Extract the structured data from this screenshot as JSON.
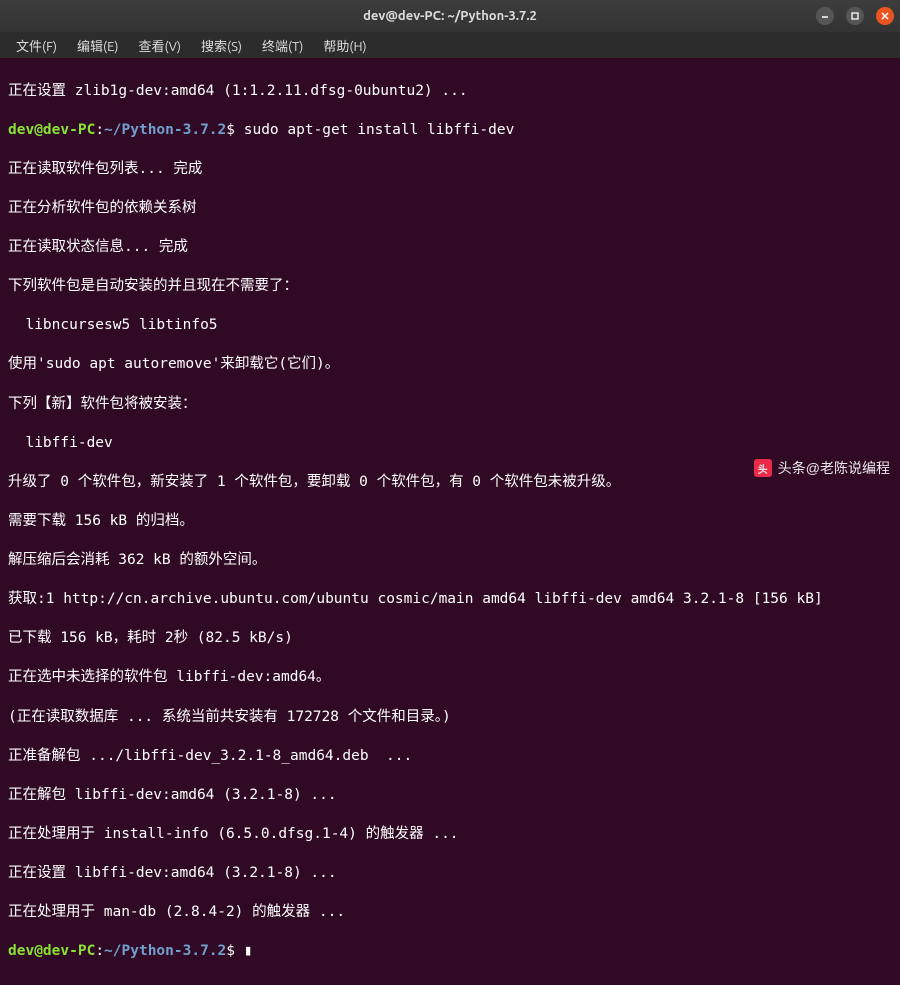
{
  "window": {
    "title": "dev@dev-PC: ~/Python-3.7.2"
  },
  "menu": {
    "file": "文件(F)",
    "edit": "编辑(E)",
    "view": "查看(V)",
    "search": "搜索(S)",
    "terminal": "终端(T)",
    "help": "帮助(H)"
  },
  "prompt": {
    "user": "dev@dev-PC",
    "colon": ":",
    "path": "~/Python-3.7.2",
    "symbol": "$"
  },
  "lines": {
    "l0": "正在设置 zlib1g-dev:amd64 (1:1.2.11.dfsg-0ubuntu2) ...",
    "cmd1": " sudo apt-get install libffi-dev",
    "l2": "正在读取软件包列表... 完成",
    "l3": "正在分析软件包的依赖关系树",
    "l4": "正在读取状态信息... 完成",
    "l5": "下列软件包是自动安装的并且现在不需要了：",
    "l6": "  libncursesw5 libtinfo5",
    "l7": "使用'sudo apt autoremove'来卸载它(它们)。",
    "l8": "下列【新】软件包将被安装：",
    "l9": "  libffi-dev",
    "l10": "升级了 0 个软件包，新安装了 1 个软件包，要卸载 0 个软件包，有 0 个软件包未被升级。",
    "l11": "需要下载 156 kB 的归档。",
    "l12": "解压缩后会消耗 362 kB 的额外空间。",
    "l13": "获取:1 http://cn.archive.ubuntu.com/ubuntu cosmic/main amd64 libffi-dev amd64 3.2.1-8 [156 kB]",
    "l14": "已下载 156 kB，耗时 2秒 (82.5 kB/s)",
    "l15": "正在选中未选择的软件包 libffi-dev:amd64。",
    "l16": "(正在读取数据库 ... 系统当前共安装有 172728 个文件和目录。)",
    "l17": "正准备解包 .../libffi-dev_3.2.1-8_amd64.deb  ...",
    "l18": "正在解包 libffi-dev:amd64 (3.2.1-8) ...",
    "l19": "正在处理用于 install-info (6.5.0.dfsg.1-4) 的触发器 ...",
    "l20": "正在设置 libffi-dev:amd64 (3.2.1-8) ...",
    "l21": "正在处理用于 man-db (2.8.4-2) 的触发器 ..."
  },
  "watermark": {
    "logo": "头",
    "text": "头条@老陈说编程"
  }
}
